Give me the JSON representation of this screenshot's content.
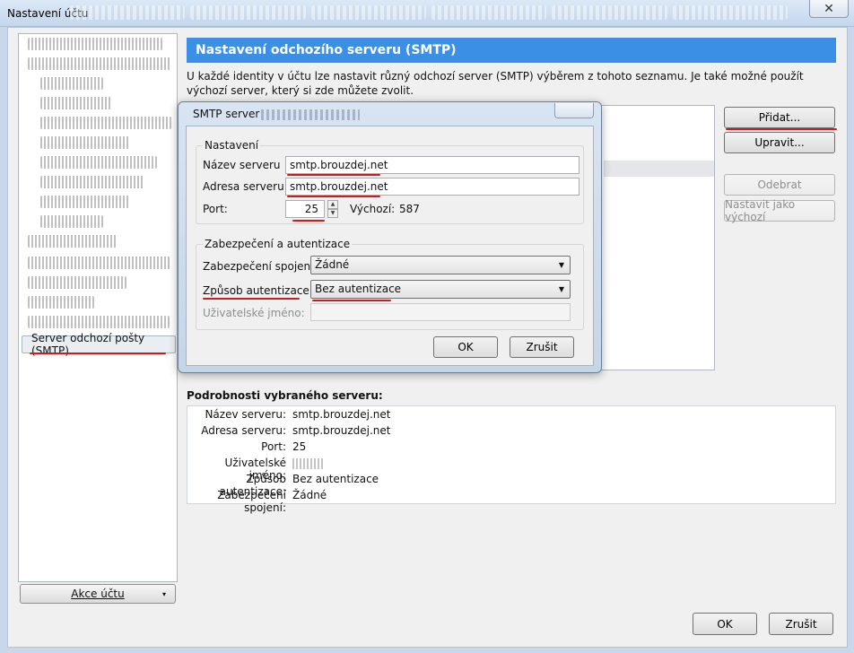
{
  "window": {
    "title": "Nastavení účtu",
    "close_glyph": "✕"
  },
  "sidebar": {
    "selected_item": "Server odchozí pošty (SMTP)",
    "account_actions_label": "Akce účtu",
    "account_actions_caret": "▾"
  },
  "main": {
    "header": "Nastavení odchozího serveru (SMTP)",
    "description": "U každé identity v účtu lze nastavit různý odchozí server (SMTP) výběrem z tohoto seznamu. Je také možné použít výchozí server, který si zde můžete zvolit.",
    "buttons": {
      "add": "Přidat...",
      "edit": "Upravit...",
      "remove": "Odebrat",
      "set_default": "Nastavit jako výchozí"
    },
    "details_title": "Podrobnosti vybraného serveru:",
    "details": [
      {
        "key": "Název serveru:",
        "value": "smtp.brouzdej.net"
      },
      {
        "key": "Adresa serveru:",
        "value": "smtp.brouzdej.net"
      },
      {
        "key": "Port:",
        "value": "25"
      },
      {
        "key": "Uživatelské jméno:",
        "value": ""
      },
      {
        "key": "Způsob autentizace:",
        "value": "Bez autentizace"
      },
      {
        "key": "Zabezpečení spojení:",
        "value": "Žádné"
      }
    ],
    "ok": "OK",
    "cancel": "Zrušit"
  },
  "dialog": {
    "title": "SMTP server",
    "settings_group": "Nastavení",
    "server_name_label": "Název serveru",
    "server_name_value": "smtp.brouzdej.net",
    "server_address_label": "Adresa serveru:",
    "server_address_value": "smtp.brouzdej.net",
    "port_label": "Port:",
    "port_value": "25",
    "default_port_label": "Výchozí:",
    "default_port_value": "587",
    "security_group": "Zabezpečení a autentizace",
    "connection_security_label": "Zabezpečení spojení:",
    "connection_security_value": "Žádné",
    "auth_method_label": "Způsob autentizace:",
    "auth_method_value": "Bez autentizace",
    "username_label": "Uživatelské jméno:",
    "username_value": "",
    "ok": "OK",
    "cancel": "Zrušit"
  },
  "colors": {
    "banner": "#3b8fe6",
    "highlight_underline": "#d21a1a"
  }
}
